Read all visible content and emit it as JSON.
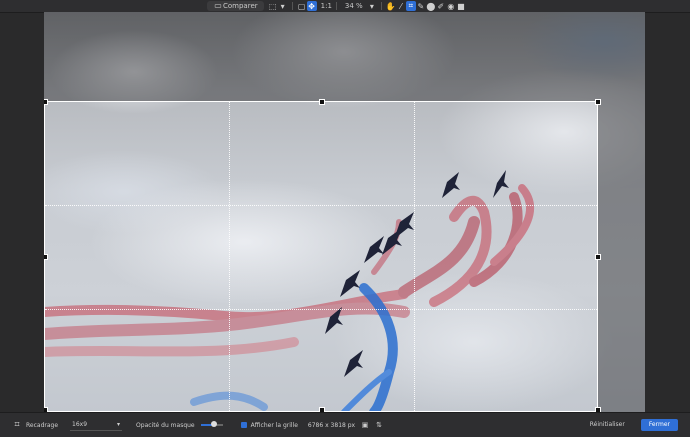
{
  "toolbar": {
    "compare_label": "Comparer",
    "ratio_label": "1:1",
    "zoom_value": "34 %",
    "icons": [
      "square-frame-icon",
      "folder-icon",
      "move-icon",
      "hand-icon",
      "brush-icon",
      "crop-icon",
      "brush-icon",
      "hand-icon",
      "pen-icon",
      "eye-icon",
      "square-icon"
    ]
  },
  "photo": {
    "subject": "",
    "plane_color": "#1f2338",
    "red_smoke": "#c64454",
    "blue_smoke": "#2b6fd0"
  },
  "bottom": {
    "crop_label": "Recadrage",
    "ratio_value": "16x9",
    "mask_opacity_label": "Opacité du masque",
    "grid_label": "Afficher la grille",
    "size_label": "6786 x 3818 px",
    "reset_label": "Réinitialiser",
    "close_label": "Fermer"
  }
}
